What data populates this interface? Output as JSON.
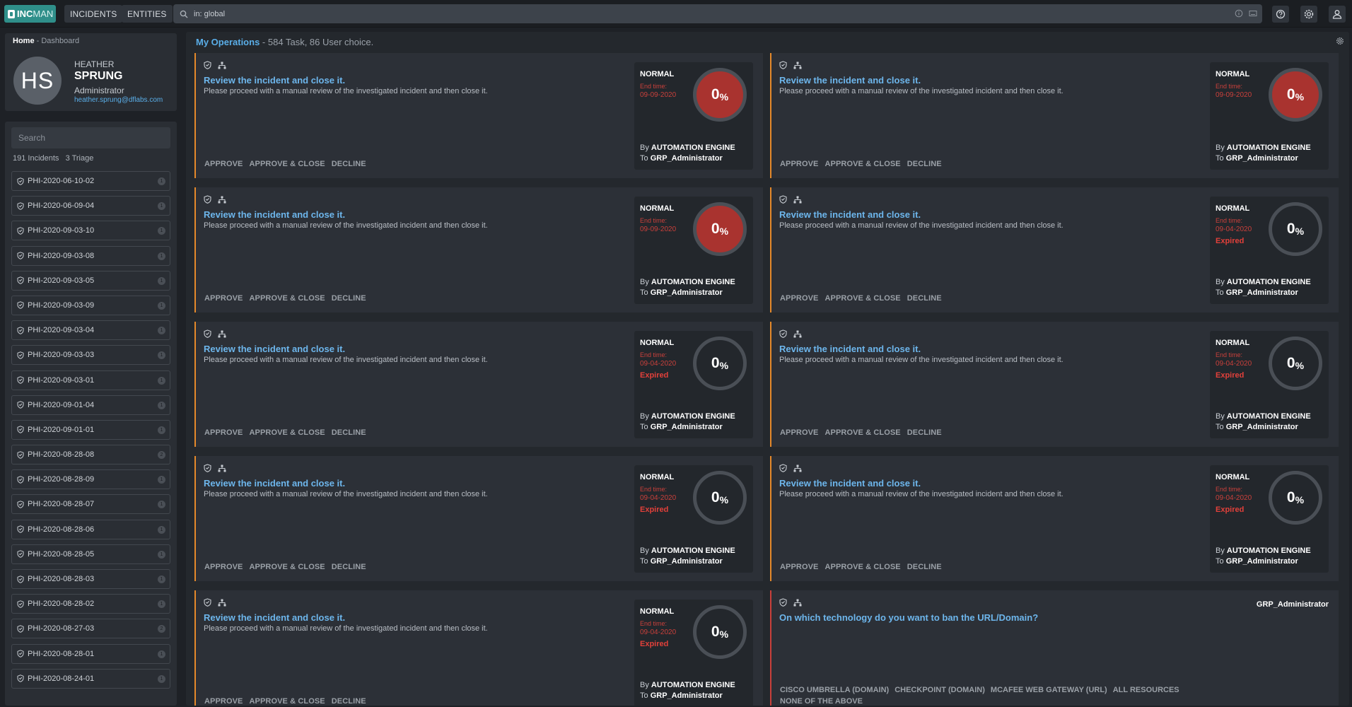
{
  "app": {
    "logo_bold": "INC",
    "logo_light": "MAN"
  },
  "nav": {
    "incidents": "INCIDENTS",
    "entities": "ENTITIES"
  },
  "search": {
    "value": "in: global"
  },
  "breadcrumb": {
    "home": "Home",
    "sep": "-",
    "current": "Dashboard"
  },
  "profile": {
    "initials": "HS",
    "first_name": "HEATHER",
    "last_name": "SPRUNG",
    "role": "Administrator",
    "email": "heather.sprung@dflabs.com"
  },
  "incidents": {
    "search_placeholder": "Search",
    "count": "191 Incidents   3 Triage",
    "items": [
      {
        "id": "PHI-2020-06-10-02",
        "n": "1"
      },
      {
        "id": "PHI-2020-06-09-04",
        "n": "1"
      },
      {
        "id": "PHI-2020-09-03-10",
        "n": "1"
      },
      {
        "id": "PHI-2020-09-03-08",
        "n": "1"
      },
      {
        "id": "PHI-2020-09-03-05",
        "n": "1"
      },
      {
        "id": "PHI-2020-09-03-09",
        "n": "1"
      },
      {
        "id": "PHI-2020-09-03-04",
        "n": "1"
      },
      {
        "id": "PHI-2020-09-03-03",
        "n": "1"
      },
      {
        "id": "PHI-2020-09-03-01",
        "n": "1"
      },
      {
        "id": "PHI-2020-09-01-04",
        "n": "1"
      },
      {
        "id": "PHI-2020-09-01-01",
        "n": "1"
      },
      {
        "id": "PHI-2020-08-28-08",
        "n": "2"
      },
      {
        "id": "PHI-2020-08-28-09",
        "n": "1"
      },
      {
        "id": "PHI-2020-08-28-07",
        "n": "1"
      },
      {
        "id": "PHI-2020-08-28-06",
        "n": "1"
      },
      {
        "id": "PHI-2020-08-28-05",
        "n": "1"
      },
      {
        "id": "PHI-2020-08-28-03",
        "n": "1"
      },
      {
        "id": "PHI-2020-08-28-02",
        "n": "1"
      },
      {
        "id": "PHI-2020-08-27-03",
        "n": "2"
      },
      {
        "id": "PHI-2020-08-28-01",
        "n": "1"
      },
      {
        "id": "PHI-2020-08-24-01",
        "n": "1"
      }
    ]
  },
  "operations": {
    "title": "My Operations",
    "sep": "-",
    "summary": "584 Task, 86 User choice.",
    "labels": {
      "end_time": "End time:",
      "expired": "Expired",
      "by": "By",
      "to": "To",
      "approve": "APPROVE",
      "approve_close": "APPROVE & CLOSE",
      "decline": "DECLINE",
      "percent_sign": "%"
    },
    "tasks": [
      {
        "title": "Review the incident and close it.",
        "desc": "Please proceed with a manual review of the investigated incident and then close it.",
        "priority": "NORMAL",
        "end_date": "09-09-2020",
        "expired": false,
        "percent": "0",
        "by": "AUTOMATION ENGINE",
        "to": "GRP_Administrator"
      },
      {
        "title": "Review the incident and close it.",
        "desc": "Please proceed with a manual review of the investigated incident and then close it.",
        "priority": "NORMAL",
        "end_date": "09-09-2020",
        "expired": false,
        "percent": "0",
        "by": "AUTOMATION ENGINE",
        "to": "GRP_Administrator"
      },
      {
        "title": "Review the incident and close it.",
        "desc": "Please proceed with a manual review of the investigated incident and then close it.",
        "priority": "NORMAL",
        "end_date": "09-09-2020",
        "expired": false,
        "percent": "0",
        "by": "AUTOMATION ENGINE",
        "to": "GRP_Administrator"
      },
      {
        "title": "Review the incident and close it.",
        "desc": "Please proceed with a manual review of the investigated incident and then close it.",
        "priority": "NORMAL",
        "end_date": "09-04-2020",
        "expired": true,
        "percent": "0",
        "by": "AUTOMATION ENGINE",
        "to": "GRP_Administrator"
      },
      {
        "title": "Review the incident and close it.",
        "desc": "Please proceed with a manual review of the investigated incident and then close it.",
        "priority": "NORMAL",
        "end_date": "09-04-2020",
        "expired": true,
        "percent": "0",
        "by": "AUTOMATION ENGINE",
        "to": "GRP_Administrator"
      },
      {
        "title": "Review the incident and close it.",
        "desc": "Please proceed with a manual review of the investigated incident and then close it.",
        "priority": "NORMAL",
        "end_date": "09-04-2020",
        "expired": true,
        "percent": "0",
        "by": "AUTOMATION ENGINE",
        "to": "GRP_Administrator"
      },
      {
        "title": "Review the incident and close it.",
        "desc": "Please proceed with a manual review of the investigated incident and then close it.",
        "priority": "NORMAL",
        "end_date": "09-04-2020",
        "expired": true,
        "percent": "0",
        "by": "AUTOMATION ENGINE",
        "to": "GRP_Administrator"
      },
      {
        "title": "Review the incident and close it.",
        "desc": "Please proceed with a manual review of the investigated incident and then close it.",
        "priority": "NORMAL",
        "end_date": "09-04-2020",
        "expired": true,
        "percent": "0",
        "by": "AUTOMATION ENGINE",
        "to": "GRP_Administrator"
      },
      {
        "title": "Review the incident and close it.",
        "desc": "Please proceed with a manual review of the investigated incident and then close it.",
        "priority": "NORMAL",
        "end_date": "09-04-2020",
        "expired": true,
        "percent": "0",
        "by": "AUTOMATION ENGINE",
        "to": "GRP_Administrator"
      }
    ],
    "choice": {
      "title": "On which technology do you want to ban the URL/Domain?",
      "group": "GRP_Administrator",
      "options": [
        "CISCO UMBRELLA (DOMAIN)",
        "CHECKPOINT (DOMAIN)",
        "MCAFEE WEB GATEWAY (URL)",
        "ALL RESOURCES",
        "NONE OF THE ABOVE"
      ]
    }
  },
  "colors": {
    "accent": "#e5892a",
    "link": "#6db6ec",
    "danger": "#a9332f",
    "brand": "#2f8f8a"
  }
}
